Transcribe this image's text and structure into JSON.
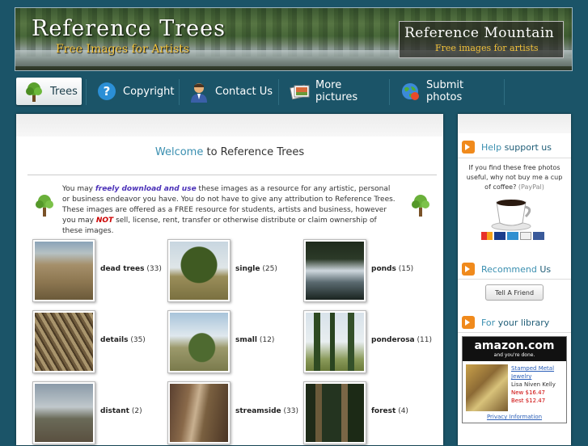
{
  "banner": {
    "title": "Reference Trees",
    "subtitle": "Free Images for Artists",
    "partner_title": "Reference Mountain",
    "partner_subtitle": "Free images for artists"
  },
  "nav": [
    {
      "label": "Trees",
      "icon": "tree-icon"
    },
    {
      "label": "Copyright",
      "icon": "help-icon"
    },
    {
      "label": "Contact Us",
      "icon": "person-icon"
    },
    {
      "label": "More pictures",
      "icon": "photos-icon"
    },
    {
      "label": "Submit photos",
      "icon": "globe-icon"
    }
  ],
  "main": {
    "welcome_prefix": "Welcome",
    "welcome_rest": " to Reference Trees",
    "intro_1": "You may ",
    "intro_em": "freely download and use",
    "intro_2": " these images as a resource for any artistic, personal or business endeavor you have. You do not have to give any attribution to Reference Trees. These images are offered as a FREE resource for students, artists and business, however you may ",
    "intro_not": "NOT",
    "intro_3": " sell, license, rent, transfer or otherwise distribute or claim ownership of these images."
  },
  "gallery": [
    {
      "name": "dead trees",
      "count": "(33)"
    },
    {
      "name": "single",
      "count": "(25)"
    },
    {
      "name": "ponds",
      "count": "(15)"
    },
    {
      "name": "details",
      "count": "(35)"
    },
    {
      "name": "small",
      "count": "(12)"
    },
    {
      "name": "ponderosa",
      "count": "(11)"
    },
    {
      "name": "distant",
      "count": "(2)"
    },
    {
      "name": "streamside",
      "count": "(33)"
    },
    {
      "name": "forest",
      "count": "(4)"
    }
  ],
  "sidebar": {
    "help_a": "Help ",
    "help_b": "support us",
    "help_text": "If you find these free photos useful, why not buy me a cup of coffee?",
    "paypal": "(PayPal)",
    "recommend_a": "Recommend ",
    "recommend_b": "Us",
    "tell_friend": "Tell A Friend",
    "library_a": "For ",
    "library_b": "your library",
    "amazon_logo": "amazon.com",
    "amazon_tag": "and you're done.",
    "amazon_product": "Stamped Metal Jewelry",
    "amazon_author": "Lisa Niven Kelly",
    "amazon_new": "New $16.47",
    "amazon_best": "Best $12.47",
    "amazon_privacy": "Privacy Information"
  },
  "colors": {
    "accent": "#3a8fb0",
    "page_bg": "#1b5468",
    "orange": "#f08a1c"
  }
}
